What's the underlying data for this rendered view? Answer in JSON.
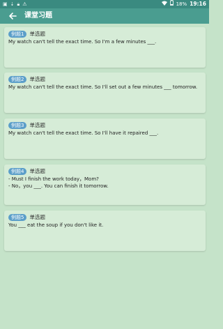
{
  "status": {
    "icons": [
      "image-icon",
      "download-icon",
      "lock-icon",
      "warning-icon"
    ],
    "battery": "18%",
    "time": "19:16"
  },
  "app": {
    "title": "课堂习题"
  },
  "questions": [
    {
      "badge": "例题1",
      "type": "单选题",
      "lines": [
        "My watch can't tell the exact time. So I'm a few minutes ___."
      ]
    },
    {
      "badge": "例题2",
      "type": "单选题",
      "lines": [
        "My watch can't tell the exact time. So I'll set out a few minutes ___ tomorrow."
      ]
    },
    {
      "badge": "例题3",
      "type": "单选题",
      "lines": [
        "My watch can't tell the exact time. So I'll have it repaired ___."
      ]
    },
    {
      "badge": "例题4",
      "type": "单选题",
      "lines": [
        "- Must I finish the work today，Mom?",
        "- No，you ___. You can finish it tomorrow."
      ]
    },
    {
      "badge": "例题5",
      "type": "单选题",
      "lines": [
        "You ___ eat the soup if you don't like it."
      ]
    }
  ],
  "colors": {
    "status_bar": "#3a8a80",
    "app_bar": "#4a9d90",
    "background": "#c5e3c9",
    "card": "#d6ecd7",
    "badge": "#5b9ec9"
  }
}
